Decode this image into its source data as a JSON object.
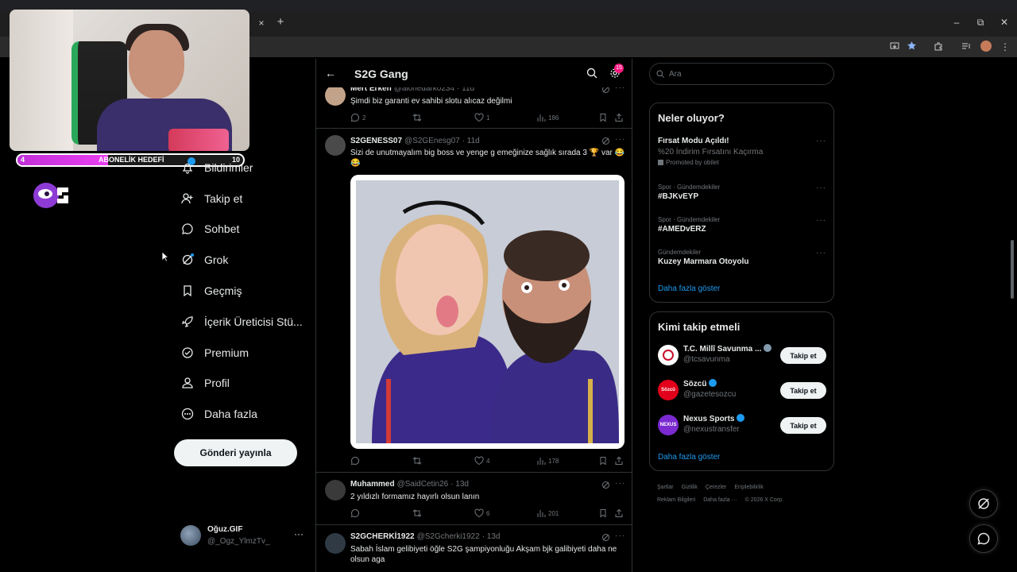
{
  "browser": {
    "tab_close": "×",
    "new_tab": "+",
    "win_min": "–",
    "win_restore": "⧉",
    "win_close": "✕"
  },
  "stream_overlay": {
    "goal_label": "ABONELİK HEDEFİ",
    "goal_current": "4",
    "goal_target": "10",
    "goal_fraction": 0.4
  },
  "nav": {
    "items": [
      {
        "label": "Bildirimler",
        "icon": "bell-icon"
      },
      {
        "label": "Takip et",
        "icon": "follow-user-icon"
      },
      {
        "label": "Sohbet",
        "icon": "chat-icon"
      },
      {
        "label": "Grok",
        "icon": "grok-icon"
      },
      {
        "label": "Geçmiş",
        "icon": "bookmark-icon"
      },
      {
        "label": "İçerik Üreticisi Stü...",
        "icon": "rocket-icon"
      },
      {
        "label": "Premium",
        "icon": "premium-icon"
      },
      {
        "label": "Profil",
        "icon": "profile-icon"
      },
      {
        "label": "Daha fazla",
        "icon": "more-circle-icon"
      }
    ],
    "post_button": "Gönderi yayınla"
  },
  "account": {
    "name": "Oğuz.GIF",
    "handle": "@_Ogz_YlmzTv_",
    "more": "···"
  },
  "main": {
    "title": "S2G Gang",
    "notification_count": "15",
    "posts": [
      {
        "author": "Mert Erken",
        "handle": "@alonedark0234",
        "time": "· 11d",
        "text": "Şimdi biz garanti ev sahibi slotu alıcaz değilmi",
        "replies": "2",
        "reposts": "",
        "likes": "1",
        "views": "186"
      },
      {
        "author": "S2GENESS07",
        "handle": "@S2GEnesg07",
        "time": "· 11d",
        "text": "Sizi de unutmayalım big boss ve yenge g emeğinize sağlık sırada 3 🏆 var 😂 😂",
        "replies": "",
        "reposts": "",
        "likes": "4",
        "views": "178"
      },
      {
        "author": "Muhammed",
        "handle": "@SaidCetin26",
        "time": "· 13d",
        "text": "2 yıldızlı formamız hayırlı olsun lanın",
        "replies": "",
        "reposts": "",
        "likes": "6",
        "views": "201"
      },
      {
        "author": "S2GCHERKİ1922",
        "handle": "@S2Gcherki1922",
        "time": "· 13d",
        "text": "Sabah İslam gelibiyeti öğle S2G şampiyonluğu Akşam bjk galibiyeti daha ne olsun aga",
        "replies": "",
        "reposts": "",
        "likes": "",
        "views": ""
      }
    ],
    "more": "···"
  },
  "sidebar": {
    "search_placeholder": "Ara",
    "trends_title": "Neler oluyor?",
    "trends": [
      {
        "category": "",
        "title": "Fırsat Modu Açıldı!",
        "subtitle": "%20 İndirim Fırsatını Kaçırma",
        "promo": "Promoted by obilet"
      },
      {
        "category": "Spor · Gündemdekiler",
        "title": "#BJKvEYP",
        "subtitle": "",
        "promo": ""
      },
      {
        "category": "Spor · Gündemdekiler",
        "title": "#AMEDvERZ",
        "subtitle": "",
        "promo": ""
      },
      {
        "category": "Gündemdekiler",
        "title": "Kuzey Marmara Otoyolu",
        "subtitle": "",
        "promo": ""
      }
    ],
    "trends_show_more": "Daha fazla göster",
    "who_title": "Kimi takip etmeli",
    "who": [
      {
        "name": "T.C. Millî Savunma ...",
        "handle": "@tcsavunma",
        "verified_color": "#829aab",
        "avatar_color": "#ffffff",
        "follow": "Takip et"
      },
      {
        "name": "Sözcü",
        "handle": "@gazetesozcu",
        "verified_color": "#1d9bf0",
        "avatar_color": "#e2001a",
        "avatar_text": "Sözcü",
        "follow": "Takip et"
      },
      {
        "name": "Nexus Sports",
        "handle": "@nexustransfer",
        "verified_color": "#1d9bf0",
        "avatar_color": "#7b2ad1",
        "avatar_text": "NEXUS",
        "follow": "Takip et"
      }
    ],
    "who_show_more": "Daha fazla göster",
    "footer": [
      "Şartlar",
      "Gizlilik",
      "Çerezler",
      "Erişilebilirlik",
      "Reklam Bilgileri",
      "Daha fazla ···",
      "© 2026 X Corp."
    ]
  },
  "colors": {
    "accent": "#1d9bf0",
    "background": "#000000",
    "border": "#2f3336",
    "muted": "#71767b",
    "text": "#e7e9ea",
    "goal_fill": "#e040fb"
  }
}
